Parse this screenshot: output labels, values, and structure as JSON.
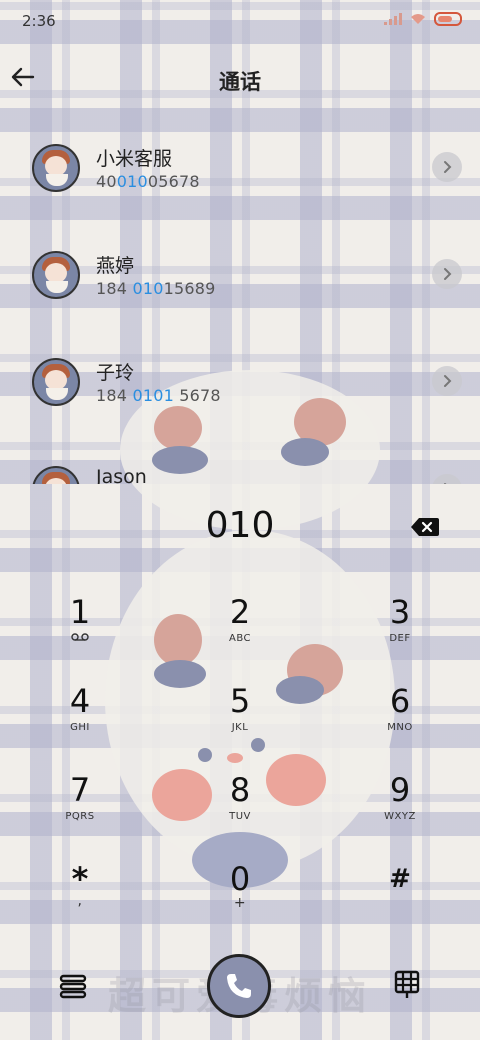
{
  "status_bar": {
    "time": "2:36"
  },
  "header": {
    "title": "通话"
  },
  "contacts": [
    {
      "name": "小米客服",
      "num_pre": "40",
      "num_hl": "010",
      "num_post": "05678"
    },
    {
      "name": "燕婷",
      "num_pre": "184 ",
      "num_hl": "010",
      "num_post": "15689"
    },
    {
      "name": "子玲",
      "num_pre": "184 ",
      "num_hl": "0101",
      "num_post": " 5678"
    },
    {
      "name": "Jason",
      "num_pre": "",
      "num_hl": "",
      "num_post": ""
    }
  ],
  "dialer": {
    "input": "010",
    "keys": [
      {
        "digit": "1",
        "letters": ""
      },
      {
        "digit": "2",
        "letters": "ABC"
      },
      {
        "digit": "3",
        "letters": "DEF"
      },
      {
        "digit": "4",
        "letters": "GHI"
      },
      {
        "digit": "5",
        "letters": "JKL"
      },
      {
        "digit": "6",
        "letters": "MNO"
      },
      {
        "digit": "7",
        "letters": "PQRS"
      },
      {
        "digit": "8",
        "letters": "TUV"
      },
      {
        "digit": "9",
        "letters": "WXYZ"
      },
      {
        "digit": "*",
        "letters": ","
      },
      {
        "digit": "0",
        "letters": "+"
      },
      {
        "digit": "#",
        "letters": ""
      }
    ]
  },
  "watermark": "超可爱毒烦恼",
  "icons": {
    "back": "arrow-left-icon",
    "chevron": "chevron-right-icon",
    "backspace": "backspace-icon",
    "voicemail": "voicemail-icon",
    "menu": "menu-icon",
    "call": "phone-icon",
    "keypad": "keypad-icon"
  },
  "colors": {
    "highlight": "#2a8ee0",
    "call_button": "#8a90ad",
    "background": "#f1eeea"
  }
}
